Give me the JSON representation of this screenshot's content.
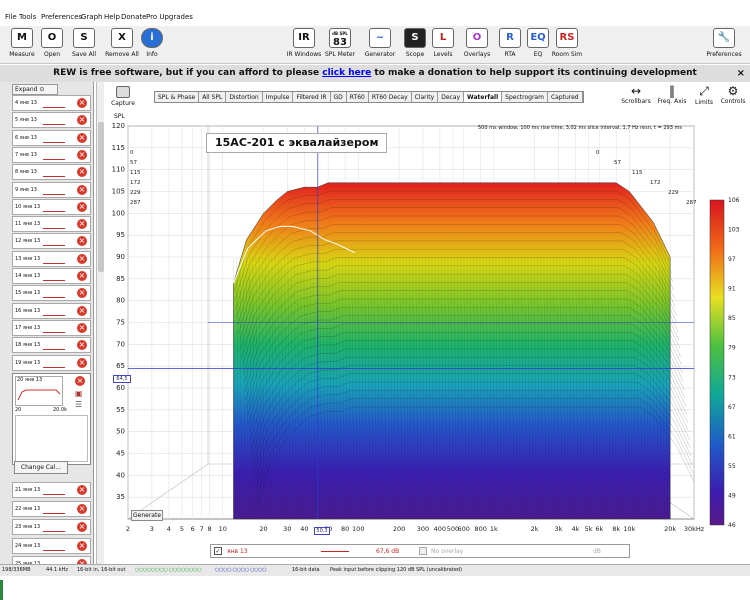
{
  "menu": [
    "File",
    "Tools",
    "Preferences",
    "Graph",
    "Help",
    "Donate",
    "Pro Upgrades"
  ],
  "toolbar_left": [
    {
      "label": "Measure",
      "icon": "M"
    },
    {
      "label": "Open",
      "icon": "O"
    },
    {
      "label": "Save All",
      "icon": "S"
    },
    {
      "label": "Remove All",
      "icon": "X"
    },
    {
      "label": "Info",
      "icon": "i"
    }
  ],
  "toolbar_center": [
    {
      "label": "IR Windows",
      "icon": "IR"
    },
    {
      "label": "SPL Meter",
      "icon": "83"
    },
    {
      "label": "Generator",
      "icon": "~"
    },
    {
      "label": "Scope",
      "icon": "S"
    },
    {
      "label": "Levels",
      "icon": "L"
    },
    {
      "label": "Overlays",
      "icon": "O"
    },
    {
      "label": "RTA",
      "icon": "R"
    },
    {
      "label": "EQ",
      "icon": "EQ"
    },
    {
      "label": "Room Sim",
      "icon": "RS"
    }
  ],
  "spl_meter_unit": "dB SPL",
  "preferences": "Preferences",
  "banner": {
    "text1": "REW is free software, but if you can afford to please",
    "link": "click here",
    "text2": "to make a donation to help support its continuing development",
    "close": "×"
  },
  "expand": "Expand",
  "measurements": [
    "4 янв 13",
    "5 янв 13",
    "6 янв 13",
    "7 янв 13",
    "8 янв 13",
    "9 янв 13",
    "10 янв 13",
    "11 янв 13",
    "12 янв 13",
    "13 янв 13",
    "14 янв 13",
    "15 янв 13",
    "16 янв 13",
    "17 янв 13",
    "18 янв 13",
    "19 янв 13"
  ],
  "selected": {
    "name": "20 янв 13",
    "min": "20",
    "max": "20.0k"
  },
  "change_cal": "Change Cal...",
  "measurements_lower": [
    "21 янв 13",
    "22 янв 13",
    "23 янв 13",
    "24 янв 13",
    "25 янв 13"
  ],
  "capture": "Capture",
  "spl_label": "SPL",
  "tabs": [
    "SPL & Phase",
    "All SPL",
    "Distortion",
    "Impulse",
    "Filtered IR",
    "GD",
    "RT60",
    "RT60 Decay",
    "Clarity",
    "Decay",
    "Waterfall",
    "Spectrogram",
    "Captured"
  ],
  "active_tab": "Waterfall",
  "right_controls": [
    "Scrollbars",
    "Freq. Axis",
    "Limits",
    "Controls"
  ],
  "chart_title": "15АС-201 с эквалайзером",
  "chart_info": "500 ms window, 100 ms rise time, 3,02 ms slice interval, 1,7 Hz resn, t = 293 ms",
  "cursor_value": "64,5",
  "cursor_freq": "50,3",
  "time_labels_left": [
    "0",
    "57",
    "115",
    "172",
    "229",
    "287"
  ],
  "time_labels_right": [
    "0",
    "57",
    "115",
    "172",
    "229",
    "287"
  ],
  "colorbar_ticks": [
    "106",
    "103",
    "97",
    "91",
    "85",
    "79",
    "73",
    "67",
    "61",
    "55",
    "49",
    "46"
  ],
  "generate": "Generate",
  "legend": {
    "name": "янв 13",
    "value": "67,6 dB",
    "overlay": "No overlay",
    "unit": "dB"
  },
  "status": [
    "198/336MB",
    "44.1 kHz",
    "16-bit in, 16-bit out",
    "16-bit data",
    "Peak input before clipping 120 dB SPL (uncalibrated)"
  ],
  "chart_data": {
    "type": "area",
    "title": "15АС-201 с эквалайзером",
    "ylabel": "SPL",
    "ylim": [
      30,
      120
    ],
    "yticks": [
      35,
      40,
      45,
      50,
      55,
      60,
      65,
      70,
      75,
      80,
      85,
      90,
      95,
      100,
      105,
      110,
      115,
      120
    ],
    "xscale": "log",
    "xlim": [
      2,
      30000
    ],
    "xtick_labels": [
      {
        "v": 2,
        "t": "2"
      },
      {
        "v": 3,
        "t": "3"
      },
      {
        "v": 4,
        "t": "4"
      },
      {
        "v": 5,
        "t": "5"
      },
      {
        "v": 6,
        "t": "6"
      },
      {
        "v": 7,
        "t": "7"
      },
      {
        "v": 8,
        "t": "8"
      },
      {
        "v": 10,
        "t": "10"
      },
      {
        "v": 20,
        "t": "20"
      },
      {
        "v": 30,
        "t": "30"
      },
      {
        "v": 40,
        "t": "40"
      },
      {
        "v": 60,
        "t": "60"
      },
      {
        "v": 80,
        "t": "80"
      },
      {
        "v": 100,
        "t": "100"
      },
      {
        "v": 200,
        "t": "200"
      },
      {
        "v": 300,
        "t": "300"
      },
      {
        "v": 400,
        "t": "400"
      },
      {
        "v": 500,
        "t": "500"
      },
      {
        "v": 600,
        "t": "600"
      },
      {
        "v": 800,
        "t": "800"
      },
      {
        "v": 1000,
        "t": "1k"
      },
      {
        "v": 2000,
        "t": "2k"
      },
      {
        "v": 3000,
        "t": "3k"
      },
      {
        "v": 4000,
        "t": "4k"
      },
      {
        "v": 5000,
        "t": "5k"
      },
      {
        "v": 6000,
        "t": "6k"
      },
      {
        "v": 8000,
        "t": "8k"
      },
      {
        "v": 10000,
        "t": "10k"
      },
      {
        "v": 20000,
        "t": "20k"
      },
      {
        "v": 30000,
        "t": "30kHz"
      }
    ],
    "front_curve": {
      "x": [
        12,
        15,
        20,
        25,
        30,
        40,
        50,
        60,
        80,
        100,
        200,
        300,
        500,
        1000,
        2000,
        3000,
        5000,
        8000,
        10000,
        15000,
        20000
      ],
      "y": [
        84,
        94,
        100,
        103,
        105,
        106,
        106,
        107,
        107,
        107,
        107,
        107,
        107,
        107,
        107,
        107,
        107,
        107,
        105,
        98,
        90
      ]
    },
    "color_scale": {
      "min": 46,
      "max": 106
    },
    "grid": true
  }
}
